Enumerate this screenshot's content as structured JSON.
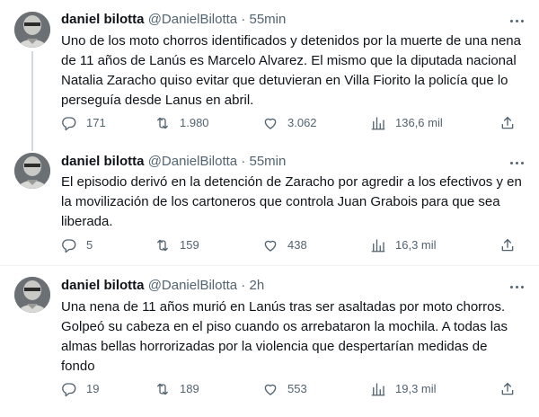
{
  "tweets": [
    {
      "name": "daniel bilotta",
      "handle": "@DanielBilotta",
      "separator": "·",
      "time": "55min",
      "text": "Uno de los moto chorros identificados y detenidos por la muerte de una nena de 11 años de Lanús es Marcelo Alvarez. El mismo que la diputada nacional Natalia Zaracho quiso evitar que detuvieran en Villa  Fiorito la policía que lo perseguía desde Lanus en abril.",
      "replies": "171",
      "retweets": "1.980",
      "likes": "3.062",
      "views": "136,6 mil"
    },
    {
      "name": "daniel bilotta",
      "handle": "@DanielBilotta",
      "separator": "·",
      "time": "55min",
      "text": "El episodio derivó en la detención de Zaracho por agredir a los efectivos y en la movilización de los cartoneros que controla Juan Grabois para que sea liberada.",
      "replies": "5",
      "retweets": "159",
      "likes": "438",
      "views": "16,3 mil"
    },
    {
      "name": "daniel bilotta",
      "handle": "@DanielBilotta",
      "separator": "·",
      "time": "2h",
      "text": "Una nena de 11 años murió en Lanús tras ser asaltadas por moto chorros. Golpeó su cabeza en el piso cuando os arrebataron la mochila. A todas las almas bellas horrorizadas por la violencia que despertarían medidas  de fondo",
      "replies": "19",
      "retweets": "189",
      "likes": "553",
      "views": "19,3 mil"
    }
  ],
  "icons": {
    "reply": "reply-icon",
    "retweet": "retweet-icon",
    "like": "like-icon",
    "views": "views-icon",
    "share": "share-icon",
    "more": "more-icon"
  },
  "colors": {
    "text": "#0f1419",
    "secondary": "#536471",
    "thread_line": "#cfd9de",
    "divider": "#eff3f4"
  }
}
